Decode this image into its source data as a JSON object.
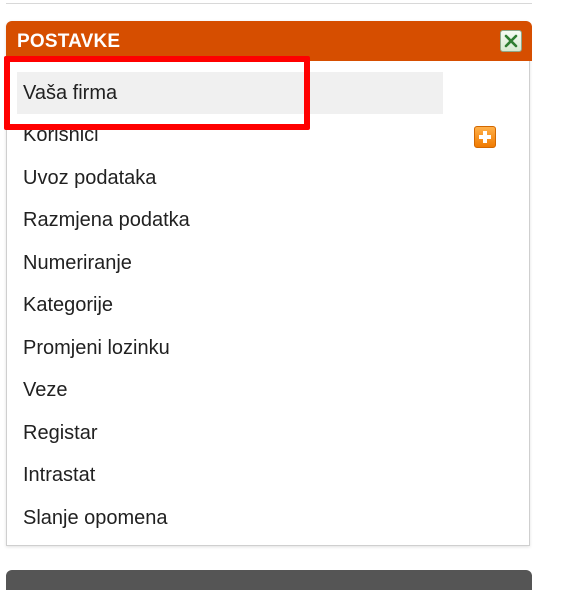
{
  "panel": {
    "title": "POSTAVKE",
    "close_icon": "close-icon",
    "add_icon": "plus-icon",
    "header_color": "#d64e00"
  },
  "menu": {
    "items": [
      {
        "label": "Vaša firma",
        "selected": true
      },
      {
        "label": "Korisnici"
      },
      {
        "label": "Uvoz podataka"
      },
      {
        "label": "Razmjena podatka"
      },
      {
        "label": "Numeriranje"
      },
      {
        "label": "Kategorije"
      },
      {
        "label": "Promjeni lozinku"
      },
      {
        "label": "Veze"
      },
      {
        "label": "Registar"
      },
      {
        "label": "Intrastat"
      },
      {
        "label": "Slanje opomena"
      }
    ]
  },
  "annotation": {
    "color": "#ff0000"
  }
}
